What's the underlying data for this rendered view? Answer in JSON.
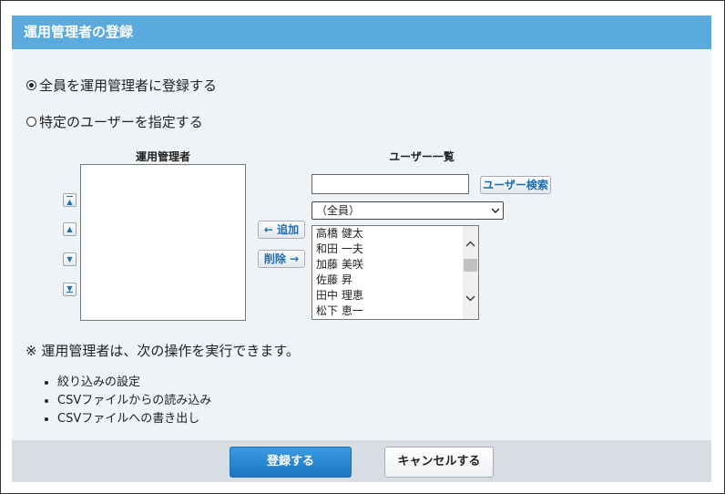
{
  "dialog": {
    "title": "運用管理者の登録"
  },
  "mode": {
    "options": [
      {
        "label": "全員を運用管理者に登録する",
        "selected": true
      },
      {
        "label": "特定のユーザーを指定する",
        "selected": false
      }
    ]
  },
  "admins": {
    "header": "運用管理者",
    "items": []
  },
  "order_buttons": {
    "icons": [
      "move-top-icon",
      "move-up-icon",
      "move-down-icon",
      "move-bottom-icon"
    ]
  },
  "transfer": {
    "add_label": "← 追加",
    "remove_label": "削除 →"
  },
  "user_list": {
    "header": "ユーザー一覧",
    "search_value": "",
    "search_button": "ユーザー検索",
    "group_select": "（全員）",
    "users": [
      "高橋 健太",
      "和田 一夫",
      "加藤 美咲",
      "佐藤 昇",
      "田中 理恵",
      "松下 恵一"
    ]
  },
  "notes": {
    "heading": "※ 運用管理者は、次の操作を実行できます。",
    "items": [
      "絞り込みの設定",
      "CSVファイルからの読み込み",
      "CSVファイルへの書き出し"
    ]
  },
  "footer": {
    "submit_label": "登録する",
    "cancel_label": "キャンセルする"
  },
  "colors": {
    "title_bar": "#5aaadd",
    "panel_bg": "#eef3f7",
    "footer_bg": "#d7dde2",
    "primary_button": "#1c77c4",
    "link_text": "#1b6db3"
  }
}
